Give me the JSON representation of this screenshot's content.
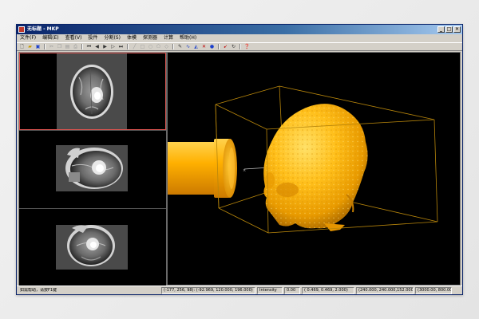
{
  "window": {
    "title": "无标题 - MKP",
    "buttons": {
      "minimize": "_",
      "maximize": "□",
      "close": "✕"
    }
  },
  "menu": [
    "文件(F)",
    "编辑(E)",
    "查看(V)",
    "投件",
    "分割(S)",
    "体模",
    "探测器",
    "计算",
    "帮助(H)"
  ],
  "toolbar": {
    "icons": [
      "new-file-icon",
      "open-folder-icon",
      "save-icon",
      "cut-icon",
      "copy-icon",
      "paste-icon",
      "print-icon",
      "first-frame-icon",
      "step-back-icon",
      "play-icon",
      "step-forward-icon",
      "last-frame-icon",
      "line-tool-icon",
      "rectangle-tool-icon",
      "circle-tool-icon",
      "polygon-tool-icon",
      "edit-tool-icon",
      "pencil-icon",
      "curve-icon",
      "node-tool-icon",
      "cross-icon",
      "sphere-icon",
      "pointer-icon",
      "rotate-icon",
      "help-icon"
    ]
  },
  "colors": {
    "title_bar": "#0a246a",
    "selected_pane_border": "#d9534f",
    "bounding_box": "#b8860b",
    "head_model": "#ffb400",
    "probe_cylinder": "#ffa500"
  },
  "viewer": {
    "panes": [
      {
        "name": "axial-slice",
        "selected": true
      },
      {
        "name": "sagittal-slice",
        "selected": false
      },
      {
        "name": "coronal-slice",
        "selected": false
      }
    ],
    "render_3d": [
      "head-surface-model",
      "probe-cylinder",
      "bounding-box"
    ]
  },
  "status": {
    "message": "如需帮助，请按F1键",
    "coords": "(-177, 256, 98): (-92.969, 120.000, 196.000)",
    "intensity_label": "Intensity",
    "intensity_value": "0.00",
    "spacing": "( 0.469, 0.469, 2.000)",
    "extent": "(240.000, 240.000,152.000)",
    "window_level": "(3000.00, 800.00)"
  }
}
